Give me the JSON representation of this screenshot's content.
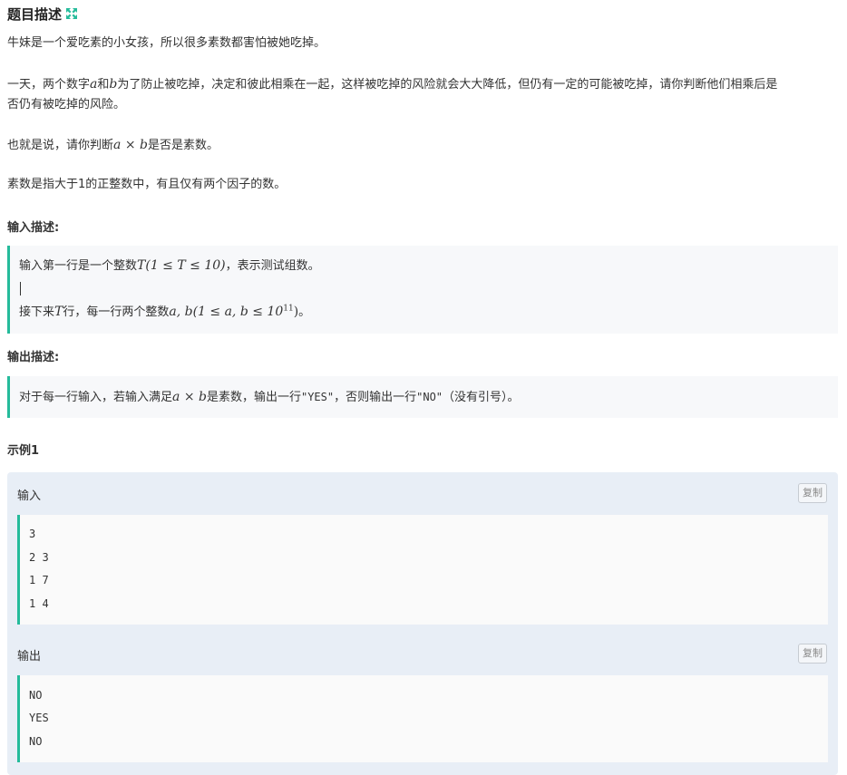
{
  "header": {
    "title": "题目描述",
    "expand_icon": "expand-arrows-icon",
    "accent": "#25bb9b"
  },
  "description": {
    "p1": "牛妹是一个爱吃素的小女孩，所以很多素数都害怕被她吃掉。",
    "p2_line1_a": "一天，两个数字",
    "p2_var_a": "a",
    "p2_and": "和",
    "p2_var_b": "b",
    "p2_line1_b": "为了防止被吃掉，决定和彼此相乘在一起，这样被吃掉的风险就会大大降低，但仍有一定的可能被吃掉，请你判断他们相乘后是",
    "p2_line2": "否仍有被吃掉的风险。",
    "p3_a": "也就是说，请你判断",
    "p3_math": "a × b",
    "p3_b": "是否是素数。",
    "p4": "素数是指大于1的正整数中，有且仅有两个因子的数。"
  },
  "input_desc": {
    "label": "输入描述:",
    "line1_a": "输入第一行是一个整数",
    "line1_math": "T(1 ≤ T ≤ 10)",
    "line1_b": "，表示测试组数。",
    "line2_a": "接下来",
    "line2_math_T": "T",
    "line2_b": "行，每一行两个整数",
    "line2_math": "a, b(1 ≤ a, b ≤ 10",
    "line2_exp": "11",
    "line2_close": ")",
    "line2_c": "。"
  },
  "output_desc": {
    "label": "输出描述:",
    "line_a": "对于每一行输入，若输入满足",
    "line_math": "a × b",
    "line_b": "是素数，输出一行",
    "yes": "\"YES\"",
    "line_c": "，否则输出一行",
    "no": "\"NO\"",
    "line_d": "（没有引号）。"
  },
  "example": {
    "label": "示例1",
    "input_label": "输入",
    "output_label": "输出",
    "copy_label": "复制",
    "input_lines": [
      "3",
      "2 3",
      "1 7",
      "1 4"
    ],
    "output_lines": [
      "NO",
      "YES",
      "NO"
    ]
  }
}
